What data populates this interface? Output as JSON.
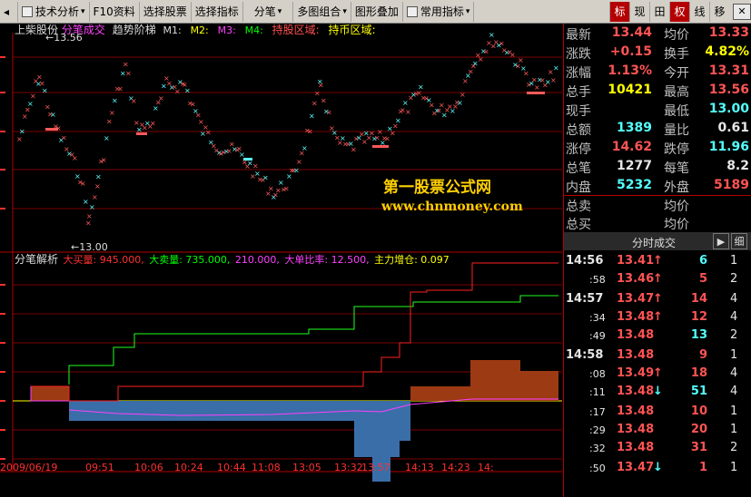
{
  "toolbar": {
    "items": [
      "技术分析",
      "F10资料",
      "选择股票",
      "选择指标",
      "分笔",
      "多图组合",
      "图形叠加",
      "常用指标"
    ],
    "tabs": [
      "标",
      "现",
      "田",
      "权",
      "线",
      "移"
    ],
    "active_tab": "权",
    "close_label": "✕"
  },
  "chart": {
    "header_stock": "上柴股份",
    "header_mode": "分笔成交",
    "indicator_name": "趋势阶梯",
    "m_labels": [
      "M1:",
      "M2:",
      "M3:",
      "M4:"
    ],
    "hold_area": "持股区域:",
    "cash_area": "持币区域:",
    "high_marker": "←13.56",
    "low_marker": "←13.00",
    "watermark_title": "第一股票公式网",
    "watermark_url": "www.chnmoney.com",
    "lower_title": "分笔解析",
    "lower_values": [
      {
        "text": "大买量: 945.000,",
        "color": "#ff3030"
      },
      {
        "text": "大卖量: 735.000,",
        "color": "#00ff00"
      },
      {
        "text": "210.000,",
        "color": "#ff40ff"
      },
      {
        "text": "大单比率: 12.500,",
        "color": "#ff40ff"
      },
      {
        "text": "主力增仓: 0.097",
        "color": "#ffff00"
      }
    ],
    "time_labels": [
      "2009/06/19",
      "09:51",
      "10:06",
      "10:24",
      "10:44",
      "11:08",
      "13:05",
      "13:32",
      "13:57",
      "14:13",
      "14:23",
      "14:"
    ],
    "colors": {
      "up": "#ff5a5a",
      "down": "#5affff",
      "buy": "#ff2020",
      "sell": "#20ff20",
      "yellow": "#ffff00",
      "magenta": "#ff40ff",
      "bar_pos": "#9c3a14",
      "bar_neg": "#3a6ea8"
    }
  },
  "quote": {
    "rows": [
      {
        "l1": "最新",
        "v1": "13.44",
        "c1": "up",
        "l2": "均价",
        "v2": "13.33",
        "c2": "up"
      },
      {
        "l1": "涨跌",
        "v1": "+0.15",
        "c1": "up",
        "l2": "换手",
        "v2": "4.82%",
        "c2": "yellow"
      },
      {
        "l1": "涨幅",
        "v1": "1.13%",
        "c1": "up",
        "l2": "今开",
        "v2": "13.31",
        "c2": "up"
      },
      {
        "l1": "总手",
        "v1": "10421",
        "c1": "yellow",
        "l2": "最高",
        "v2": "13.56",
        "c2": "up"
      },
      {
        "l1": "现手",
        "v1": "",
        "c1": "white",
        "l2": "最低",
        "v2": "13.00",
        "c2": "down"
      },
      {
        "l1": "总额",
        "v1": "1389",
        "c1": "down",
        "l2": "量比",
        "v2": "0.61",
        "c2": "white"
      },
      {
        "l1": "涨停",
        "v1": "14.62",
        "c1": "up",
        "l2": "跌停",
        "v2": "11.96",
        "c2": "down"
      },
      {
        "l1": "总笔",
        "v1": "1277",
        "c1": "white",
        "l2": "每笔",
        "v2": "8.2",
        "c2": "white"
      },
      {
        "l1": "内盘",
        "v1": "5232",
        "c1": "down",
        "l2": "外盘",
        "v2": "5189",
        "c2": "up"
      }
    ],
    "sell_label": "总卖",
    "sell_avg_label": "均价",
    "buy_label": "总买",
    "buy_avg_label": "均价"
  },
  "ticks": {
    "title": "分时成交",
    "btn_play": "▶",
    "btn_detail": "细",
    "rows": [
      {
        "time": "14:56",
        "full": true,
        "price": "13.41",
        "pc": "up",
        "arrow": "↑",
        "ac": "up",
        "vol": "6",
        "vc": "down",
        "num": "1"
      },
      {
        "time": ":58",
        "full": false,
        "price": "13.46",
        "pc": "up",
        "arrow": "↑",
        "ac": "up",
        "vol": "5",
        "vc": "up",
        "num": "2"
      },
      {
        "time": "14:57",
        "full": true,
        "price": "13.47",
        "pc": "up",
        "arrow": "↑",
        "ac": "up",
        "vol": "14",
        "vc": "up",
        "num": "4"
      },
      {
        "time": ":34",
        "full": false,
        "price": "13.48",
        "pc": "up",
        "arrow": "↑",
        "ac": "up",
        "vol": "12",
        "vc": "up",
        "num": "4"
      },
      {
        "time": ":49",
        "full": false,
        "price": "13.48",
        "pc": "up",
        "arrow": "",
        "ac": "up",
        "vol": "13",
        "vc": "down",
        "num": "2"
      },
      {
        "time": "14:58",
        "full": true,
        "price": "13.48",
        "pc": "up",
        "arrow": "",
        "ac": "up",
        "vol": "9",
        "vc": "up",
        "num": "1"
      },
      {
        "time": ":08",
        "full": false,
        "price": "13.49",
        "pc": "up",
        "arrow": "↑",
        "ac": "up",
        "vol": "18",
        "vc": "up",
        "num": "4"
      },
      {
        "time": ":11",
        "full": false,
        "price": "13.48",
        "pc": "up",
        "arrow": "↓",
        "ac": "down",
        "vol": "51",
        "vc": "down",
        "num": "4"
      },
      {
        "time": ":17",
        "full": false,
        "price": "13.48",
        "pc": "up",
        "arrow": "",
        "ac": "up",
        "vol": "10",
        "vc": "up",
        "num": "1"
      },
      {
        "time": ":29",
        "full": false,
        "price": "13.48",
        "pc": "up",
        "arrow": "",
        "ac": "up",
        "vol": "20",
        "vc": "up",
        "num": "1"
      },
      {
        "time": ":32",
        "full": false,
        "price": "13.48",
        "pc": "up",
        "arrow": "",
        "ac": "up",
        "vol": "31",
        "vc": "up",
        "num": "2"
      },
      {
        "time": ":50",
        "full": false,
        "price": "13.47",
        "pc": "up",
        "arrow": "↓",
        "ac": "down",
        "vol": "1",
        "vc": "up",
        "num": "1"
      }
    ]
  }
}
